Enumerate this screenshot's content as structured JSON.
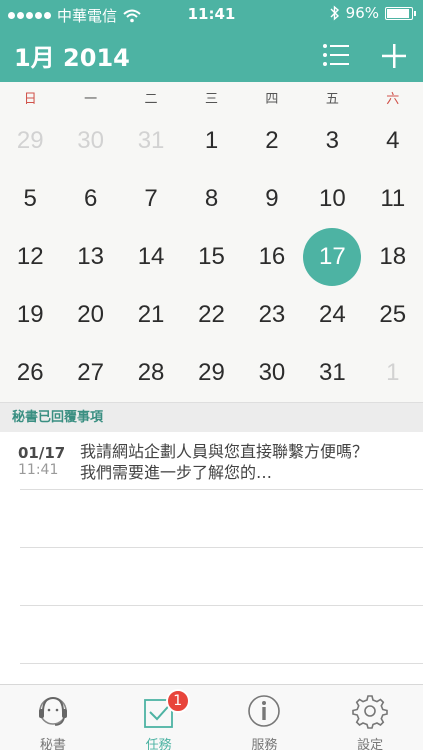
{
  "status": {
    "carrier": "中華電信",
    "time": "11:41",
    "battery": "96%"
  },
  "header": {
    "title": "1月 2014"
  },
  "weekdays": [
    "日",
    "一",
    "二",
    "三",
    "四",
    "五",
    "六"
  ],
  "days": [
    {
      "d": "29",
      "m": true
    },
    {
      "d": "30",
      "m": true
    },
    {
      "d": "31",
      "m": true
    },
    {
      "d": "1"
    },
    {
      "d": "2"
    },
    {
      "d": "3"
    },
    {
      "d": "4"
    },
    {
      "d": "5"
    },
    {
      "d": "6"
    },
    {
      "d": "7"
    },
    {
      "d": "8"
    },
    {
      "d": "9"
    },
    {
      "d": "10"
    },
    {
      "d": "11"
    },
    {
      "d": "12"
    },
    {
      "d": "13"
    },
    {
      "d": "14"
    },
    {
      "d": "15"
    },
    {
      "d": "16"
    },
    {
      "d": "17",
      "t": true
    },
    {
      "d": "18"
    },
    {
      "d": "19"
    },
    {
      "d": "20"
    },
    {
      "d": "21"
    },
    {
      "d": "22"
    },
    {
      "d": "23"
    },
    {
      "d": "24"
    },
    {
      "d": "25"
    },
    {
      "d": "26"
    },
    {
      "d": "27"
    },
    {
      "d": "28"
    },
    {
      "d": "29"
    },
    {
      "d": "30"
    },
    {
      "d": "31"
    },
    {
      "d": "1",
      "m": true
    }
  ],
  "section": {
    "title": "秘書已回覆事項"
  },
  "messages": [
    {
      "date": "01/17",
      "time": "11:41",
      "text": "我請網站企劃人員與您直接聯繫方便嗎？我們需要進一步了解您的…"
    }
  ],
  "tabs": [
    {
      "label": "秘書"
    },
    {
      "label": "任務",
      "badge": "1"
    },
    {
      "label": "服務"
    },
    {
      "label": "設定"
    }
  ],
  "colors": {
    "accent": "#4db3a3",
    "badge": "#e8453c"
  }
}
